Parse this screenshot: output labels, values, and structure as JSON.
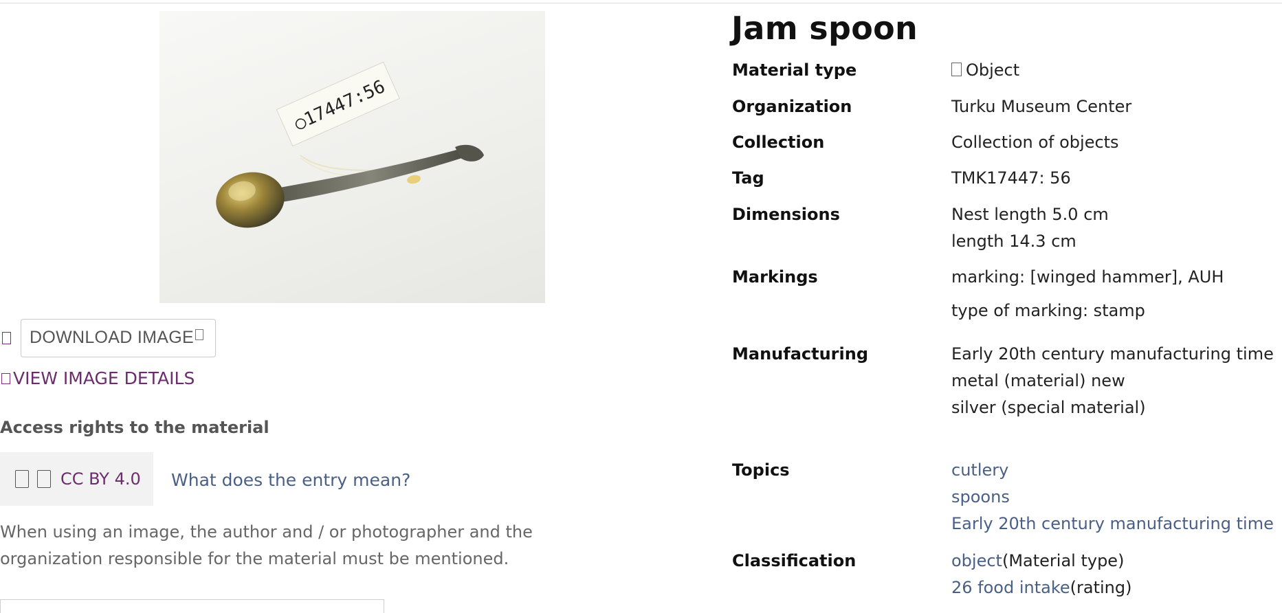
{
  "record": {
    "title": "Jam spoon",
    "image_tag_text": "○17447:56"
  },
  "actions": {
    "download_label": "DOWNLOAD IMAGE",
    "view_details_label": "VIEW IMAGE DETAILS"
  },
  "rights": {
    "heading": "Access rights to the material",
    "license": "CC BY 4.0",
    "what_link": "What does the entry mean?",
    "usage_note": "When using an image, the author and / or photographer and the organization responsible for the material must be mentioned."
  },
  "fields": {
    "material_type": {
      "label": "Material type",
      "value": "Object"
    },
    "organization": {
      "label": "Organization",
      "value": "Turku Museum Center"
    },
    "collection": {
      "label": "Collection",
      "value": "Collection of objects"
    },
    "tag": {
      "label": "Tag",
      "value": "TMK17447: 56"
    },
    "dimensions": {
      "label": "Dimensions",
      "values": [
        "Nest length 5.0 cm",
        "length 14.3 cm"
      ]
    },
    "markings": {
      "label": "Markings",
      "values": [
        "marking: [winged hammer], AUH",
        "type of marking: stamp"
      ]
    },
    "manufacturing": {
      "label": "Manufacturing",
      "values": [
        "Early 20th century manufacturing time",
        "metal (material) new",
        "silver (special material)"
      ]
    },
    "topics": {
      "label": "Topics",
      "links": [
        "cutlery",
        "spoons",
        "Early 20th century manufacturing time"
      ]
    },
    "classification": {
      "label": "Classification",
      "items": [
        {
          "link": "object",
          "suffix": "(Material type)"
        },
        {
          "link": "26 food intake",
          "suffix": "(rating)"
        }
      ]
    }
  },
  "icons": {
    "favorite": "bookmark-icon",
    "external": "external-link-icon",
    "details": "image-details-icon",
    "license_cc": "cc-icon",
    "license_by": "by-icon",
    "material_type": "object-icon"
  },
  "colors": {
    "link": "#4a5f86",
    "accent": "#6b2d6b"
  }
}
